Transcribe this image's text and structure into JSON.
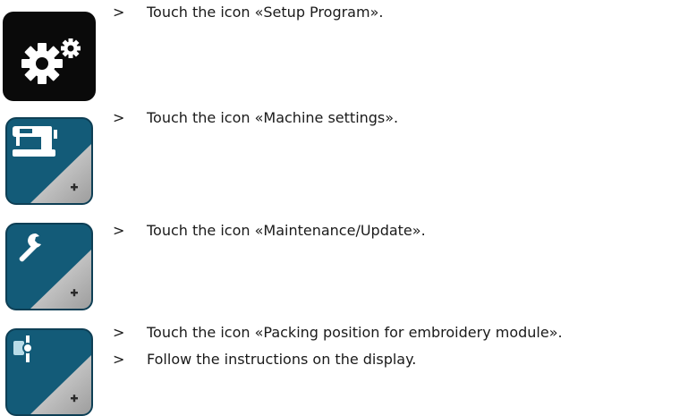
{
  "steps": [
    {
      "icon": "setup-program-gears-icon",
      "prefix": ">",
      "text": "Touch the icon «Setup Program»."
    },
    {
      "icon": "machine-settings-sewing-machine-icon",
      "prefix": ">",
      "text": "Touch the icon «Machine settings»."
    },
    {
      "icon": "maintenance-wrench-icon",
      "prefix": ">",
      "text": "Touch the icon «Maintenance/Update»."
    },
    {
      "icon": "embroidery-module-packing-icon",
      "prefix": ">",
      "text": "Touch the icon «Packing position for embroidery module»."
    },
    {
      "icon": null,
      "prefix": ">",
      "text": "Follow the instructions on the display."
    }
  ],
  "colors": {
    "icon_blue": "#135b78",
    "icon_black": "#0a0a0a",
    "corner_gray": "#c9c9c9",
    "text": "#1a1a1a"
  }
}
